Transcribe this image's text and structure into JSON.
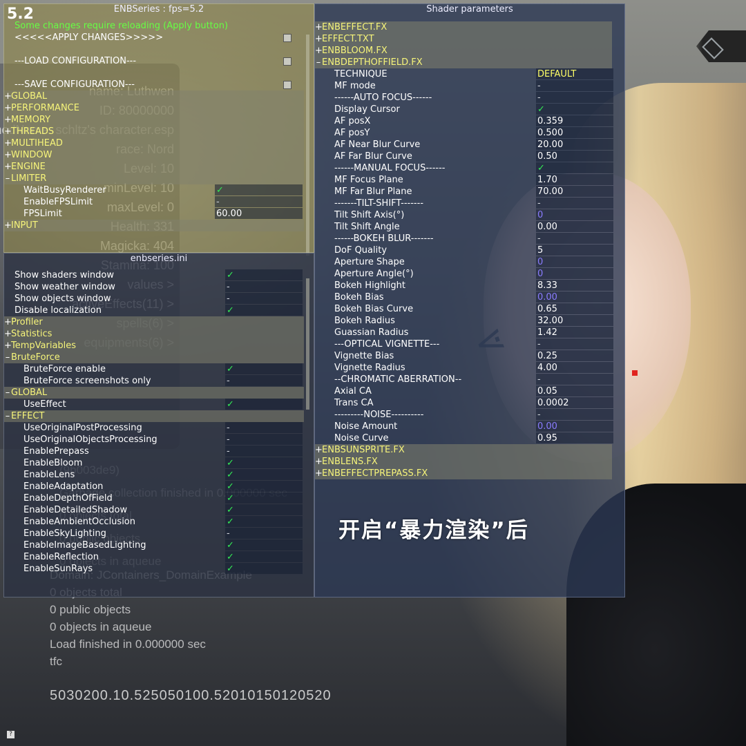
{
  "enb_window": {
    "fps_badge": "5.2",
    "title": "ENBSeries : fps=5.2",
    "notice": "Some changes require reloading (Apply button)",
    "actions": [
      {
        "label": "<<<<<APPLY CHANGES>>>>>"
      },
      {
        "label": "---LOAD CONFIGURATION---"
      },
      {
        "label": "---SAVE CONFIGURATION---"
      }
    ],
    "sections": [
      {
        "sign": "+",
        "label": "GLOBAL"
      },
      {
        "sign": "+",
        "label": "PERFORMANCE"
      },
      {
        "sign": "+",
        "label": "MEMORY"
      },
      {
        "sign": "+",
        "label": "THREADS"
      },
      {
        "sign": "+",
        "label": "MULTIHEAD"
      },
      {
        "sign": "+",
        "label": "WINDOW"
      },
      {
        "sign": "+",
        "label": "ENGINE"
      },
      {
        "sign": "–",
        "label": "LIMITER"
      }
    ],
    "limiter_items": [
      {
        "label": "WaitBusyRenderer",
        "value": "✓",
        "kind": "check"
      },
      {
        "label": "EnableFPSLimit",
        "value": "-",
        "kind": "dash"
      },
      {
        "label": "FPSLimit",
        "value": "60.00",
        "kind": "text"
      }
    ],
    "input_section": {
      "sign": "+",
      "label": "INPUT"
    }
  },
  "ini_window": {
    "title": "enbseries.ini",
    "top_items": [
      {
        "label": "Show shaders window",
        "value": "✓",
        "kind": "check"
      },
      {
        "label": "Show weather window",
        "value": "-",
        "kind": "dash"
      },
      {
        "label": "Show objects window",
        "value": "-",
        "kind": "dash"
      },
      {
        "label": "Disable localization",
        "value": "✓",
        "kind": "check"
      }
    ],
    "collapsed_sections": [
      {
        "sign": "+",
        "label": "Profiler"
      },
      {
        "sign": "+",
        "label": "Statistics"
      },
      {
        "sign": "+",
        "label": "TempVariables"
      }
    ],
    "bruteforce": {
      "sign": "–",
      "label": "BruteForce",
      "items": [
        {
          "label": "BruteForce enable",
          "value": "✓",
          "kind": "check"
        },
        {
          "label": "BruteForce screenshots only",
          "value": "-",
          "kind": "dash"
        }
      ]
    },
    "global": {
      "sign": "–",
      "label": "GLOBAL",
      "items": [
        {
          "label": "UseEffect",
          "value": "✓",
          "kind": "check"
        }
      ]
    },
    "effect": {
      "sign": "–",
      "label": "EFFECT",
      "items": [
        {
          "label": "UseOriginalPostProcessing",
          "value": "-",
          "kind": "dash"
        },
        {
          "label": "UseOriginalObjectsProcessing",
          "value": "-",
          "kind": "dash"
        },
        {
          "label": "EnablePrepass",
          "value": "-",
          "kind": "dash"
        },
        {
          "label": "EnableBloom",
          "value": "✓",
          "kind": "check"
        },
        {
          "label": "EnableLens",
          "value": "✓",
          "kind": "check"
        },
        {
          "label": "EnableAdaptation",
          "value": "✓",
          "kind": "check"
        },
        {
          "label": "EnableDepthOfField",
          "value": "✓",
          "kind": "check"
        },
        {
          "label": "EnableDetailedShadow",
          "value": "✓",
          "kind": "check"
        },
        {
          "label": "EnableAmbientOcclusion",
          "value": "✓",
          "kind": "check"
        },
        {
          "label": "EnableSkyLighting",
          "value": "-",
          "kind": "dash"
        },
        {
          "label": "EnableImageBasedLighting",
          "value": "✓",
          "kind": "check"
        },
        {
          "label": "EnableReflection",
          "value": "✓",
          "kind": "check"
        },
        {
          "label": "EnableSunRays",
          "value": "✓",
          "kind": "check"
        }
      ]
    }
  },
  "shader_window": {
    "title": "Shader parameters",
    "files_before": [
      {
        "sign": "+",
        "label": "ENBEFFECT.FX"
      },
      {
        "sign": "+",
        "label": "EFFECT.TXT"
      },
      {
        "sign": "+",
        "label": "ENBBLOOM.FX"
      }
    ],
    "dof_file": {
      "sign": "–",
      "label": "ENBDEPTHOFFIELD.FX"
    },
    "params": [
      {
        "label": "TECHNIQUE",
        "value": "DEFAULT",
        "kind": "tech"
      },
      {
        "label": "MF mode",
        "value": "-",
        "kind": "dash"
      },
      {
        "label": "------AUTO FOCUS------",
        "value": "-",
        "kind": "dash"
      },
      {
        "label": "Display Cursor",
        "value": "✓",
        "kind": "check"
      },
      {
        "label": "AF posX",
        "value": "0.359",
        "kind": "text"
      },
      {
        "label": "AF posY",
        "value": "0.500",
        "kind": "text"
      },
      {
        "label": "AF Near Blur Curve",
        "value": "20.00",
        "kind": "text"
      },
      {
        "label": "AF Far Blur Curve",
        "value": "0.50",
        "kind": "text"
      },
      {
        "label": "------MANUAL FOCUS------",
        "value": "✓",
        "kind": "check"
      },
      {
        "label": "MF Focus Plane",
        "value": "1.70",
        "kind": "text"
      },
      {
        "label": "MF Far Blur Plane",
        "value": "70.00",
        "kind": "text"
      },
      {
        "label": "-------TILT-SHIFT-------",
        "value": "-",
        "kind": "dash"
      },
      {
        "label": "Tilt Shift Axis(°)",
        "value": "0",
        "kind": "purple"
      },
      {
        "label": "Tilt Shift Angle",
        "value": "0.00",
        "kind": "text"
      },
      {
        "label": "------BOKEH BLUR-------",
        "value": "-",
        "kind": "dash"
      },
      {
        "label": "DoF Quality",
        "value": "5",
        "kind": "text"
      },
      {
        "label": "Aperture Shape",
        "value": "0",
        "kind": "purple"
      },
      {
        "label": "Aperture Angle(°)",
        "value": "0",
        "kind": "purple"
      },
      {
        "label": "Bokeh Highlight",
        "value": "8.33",
        "kind": "text"
      },
      {
        "label": "Bokeh Bias",
        "value": "0.00",
        "kind": "purple"
      },
      {
        "label": "Bokeh Bias Curve",
        "value": "0.65",
        "kind": "text"
      },
      {
        "label": "Bokeh Radius",
        "value": "32.00",
        "kind": "text"
      },
      {
        "label": "Guassian Radius",
        "value": "1.42",
        "kind": "text"
      },
      {
        "label": "---OPTICAL VIGNETTE---",
        "value": "-",
        "kind": "dash"
      },
      {
        "label": "Vignette Bias",
        "value": "0.25",
        "kind": "text"
      },
      {
        "label": "Vignette Radius",
        "value": "4.00",
        "kind": "text"
      },
      {
        "label": "--CHROMATIC ABERRATION--",
        "value": "-",
        "kind": "dash"
      },
      {
        "label": "Axial CA",
        "value": "0.05",
        "kind": "text"
      },
      {
        "label": "Trans CA",
        "value": "0.0002",
        "kind": "text"
      },
      {
        "label": "---------NOISE----------",
        "value": "-",
        "kind": "dash"
      },
      {
        "label": "Noise Amount",
        "value": "0.00",
        "kind": "purple"
      },
      {
        "label": "Noise Curve",
        "value": "0.95",
        "kind": "text"
      }
    ],
    "files_after": [
      {
        "sign": "+",
        "label": "ENBSUNSPRITE.FX"
      },
      {
        "sign": "+",
        "label": "ENBLENS.FX"
      },
      {
        "sign": "+",
        "label": "ENBEFFECTPREPASS.FX"
      }
    ]
  },
  "hud": {
    "stats": [
      "name: Luthwen",
      "ID: 80000000",
      "modName: schltz's character.esp",
      "race: Nord",
      "Level: 10",
      "minLevel: 10",
      "maxLevel: 0",
      "Health: 331",
      "Magicka: 404",
      "Stamina: 100",
      "values >",
      "activeEffects(11) >",
      "spells(6) >",
      "equipments(6) >"
    ],
    "log_partial": [
      "(9b003de9)",
      "Garbage collection finished in 0.000000 sec",
      "0 objects total",
      "0 public objects",
      "0 objects in aqueue"
    ],
    "log_lines": [
      "Domain: JContainers_DomainExample",
      "0 objects total",
      "0 public objects",
      "0 objects in aqueue",
      "Load finished in 0.000000 sec",
      "tfc"
    ],
    "number_line": "5030200.10.525050100.52010150120520"
  },
  "caption": "开启“暴力渲染”后",
  "colors": {
    "section_label": "#f6f47a",
    "check": "#33ee55",
    "purple_value": "#8a7cff",
    "technique_value": "#ffff66"
  },
  "icons": [
    "compass-badge-icon",
    "red-marker-dot",
    "bottom-help-icon"
  ]
}
